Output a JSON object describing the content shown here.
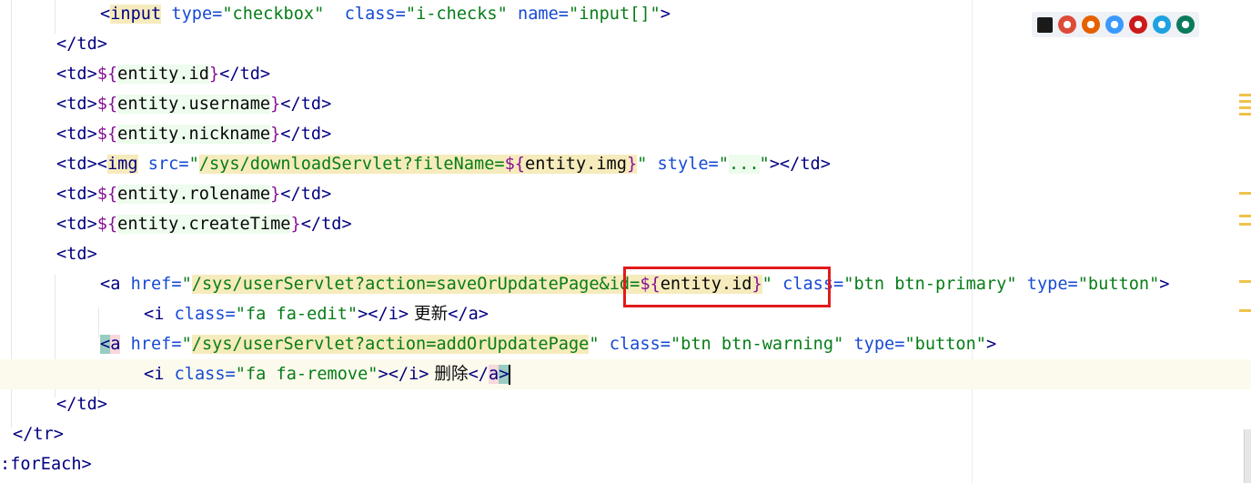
{
  "editor": {
    "lines": [
      {
        "tokens": [
          {
            "t": "<",
            "c": "tk-tag"
          },
          {
            "t": "input",
            "c": "tk-tag hl-y"
          },
          {
            "t": " type=",
            "c": "tk-attr"
          },
          {
            "t": "\"checkbox\"",
            "c": "tk-str"
          },
          {
            "t": "  class=",
            "c": "tk-attr"
          },
          {
            "t": "\"i-checks\"",
            "c": "tk-str"
          },
          {
            "t": " name=",
            "c": "tk-attr"
          },
          {
            "t": "\"input[]\"",
            "c": "tk-str"
          },
          {
            "t": ">",
            "c": "tk-tag"
          }
        ]
      },
      {
        "tokens": [
          {
            "t": "</td>",
            "c": "tk-tag"
          }
        ]
      },
      {
        "tokens": [
          {
            "t": "<td>",
            "c": "tk-tag"
          },
          {
            "t": "${",
            "c": "tk-el"
          },
          {
            "t": "entity.id",
            "c": "tk-txt hl-g"
          },
          {
            "t": "}",
            "c": "tk-el"
          },
          {
            "t": "</td>",
            "c": "tk-tag"
          }
        ]
      },
      {
        "tokens": [
          {
            "t": "<td>",
            "c": "tk-tag"
          },
          {
            "t": "${",
            "c": "tk-el"
          },
          {
            "t": "entity.username",
            "c": "tk-txt hl-g"
          },
          {
            "t": "}",
            "c": "tk-el"
          },
          {
            "t": "</td>",
            "c": "tk-tag"
          }
        ]
      },
      {
        "tokens": [
          {
            "t": "<td>",
            "c": "tk-tag"
          },
          {
            "t": "${",
            "c": "tk-el"
          },
          {
            "t": "entity.nickname",
            "c": "tk-txt hl-g"
          },
          {
            "t": "}",
            "c": "tk-el"
          },
          {
            "t": "</td>",
            "c": "tk-tag"
          }
        ]
      },
      {
        "tokens": [
          {
            "t": "<td>",
            "c": "tk-tag"
          },
          {
            "t": "<",
            "c": "tk-tag"
          },
          {
            "t": "img",
            "c": "tk-tag hl-y"
          },
          {
            "t": " src=",
            "c": "tk-attr"
          },
          {
            "t": "\"",
            "c": "tk-str"
          },
          {
            "t": "/sys/downloadServlet?fileName=",
            "c": "tk-str hl-y"
          },
          {
            "t": "${",
            "c": "tk-el hl-y"
          },
          {
            "t": "entity.img",
            "c": "tk-txt hl-y"
          },
          {
            "t": "}",
            "c": "tk-el hl-y"
          },
          {
            "t": "\"",
            "c": "tk-str"
          },
          {
            "t": " style=",
            "c": "tk-attr"
          },
          {
            "t": "\"",
            "c": "tk-str"
          },
          {
            "t": "...",
            "c": "tk-str hl-g"
          },
          {
            "t": "\"",
            "c": "tk-str"
          },
          {
            "t": "></td>",
            "c": "tk-tag"
          }
        ]
      },
      {
        "tokens": [
          {
            "t": "<td>",
            "c": "tk-tag"
          },
          {
            "t": "${",
            "c": "tk-el"
          },
          {
            "t": "entity.rolename",
            "c": "tk-txt hl-g"
          },
          {
            "t": "}",
            "c": "tk-el"
          },
          {
            "t": "</td>",
            "c": "tk-tag"
          }
        ]
      },
      {
        "tokens": [
          {
            "t": "<td>",
            "c": "tk-tag"
          },
          {
            "t": "${",
            "c": "tk-el"
          },
          {
            "t": "entity.createTime",
            "c": "tk-txt hl-g"
          },
          {
            "t": "}",
            "c": "tk-el"
          },
          {
            "t": "</td>",
            "c": "tk-tag"
          }
        ]
      },
      {
        "tokens": [
          {
            "t": "<td>",
            "c": "tk-tag"
          }
        ]
      },
      {
        "tokens": [
          {
            "t": "<a",
            "c": "tk-tag"
          },
          {
            "t": " href=",
            "c": "tk-attr"
          },
          {
            "t": "\"",
            "c": "tk-str"
          },
          {
            "t": "/sys/userServlet?action=saveOrUpdatePage&id=",
            "c": "tk-str hl-y"
          },
          {
            "t": "${",
            "c": "tk-el hl-y"
          },
          {
            "t": "entity.id",
            "c": "tk-txt hl-y"
          },
          {
            "t": "}",
            "c": "tk-el hl-y"
          },
          {
            "t": "\"",
            "c": "tk-str"
          },
          {
            "t": " class=",
            "c": "tk-attr"
          },
          {
            "t": "\"btn btn-primary\"",
            "c": "tk-str"
          },
          {
            "t": " type=",
            "c": "tk-attr"
          },
          {
            "t": "\"button\"",
            "c": "tk-str"
          },
          {
            "t": ">",
            "c": "tk-tag"
          }
        ]
      },
      {
        "tokens": [
          {
            "t": "<i",
            "c": "tk-tag"
          },
          {
            "t": " class=",
            "c": "tk-attr"
          },
          {
            "t": "\"fa fa-edit\"",
            "c": "tk-str"
          },
          {
            "t": "></i>",
            "c": "tk-tag"
          },
          {
            "t": " 更新",
            "c": "tk-txt cjk"
          },
          {
            "t": "</a>",
            "c": "tk-tag"
          }
        ]
      },
      {
        "tokens": [
          {
            "t": "<",
            "c": "tk-tag hl-c"
          },
          {
            "t": "a",
            "c": "tk-tag hl-p"
          },
          {
            "t": " href=",
            "c": "tk-attr"
          },
          {
            "t": "\"",
            "c": "tk-str"
          },
          {
            "t": "/sys/userServlet?action=addOrUpdatePage",
            "c": "tk-str hl-y"
          },
          {
            "t": "\"",
            "c": "tk-str"
          },
          {
            "t": " class=",
            "c": "tk-attr"
          },
          {
            "t": "\"btn btn-warning\"",
            "c": "tk-str"
          },
          {
            "t": " type=",
            "c": "tk-attr"
          },
          {
            "t": "\"button\"",
            "c": "tk-str"
          },
          {
            "t": ">",
            "c": "tk-tag"
          }
        ]
      },
      {
        "tokens": [
          {
            "t": "<i",
            "c": "tk-tag"
          },
          {
            "t": " class=",
            "c": "tk-attr"
          },
          {
            "t": "\"fa fa-remove\"",
            "c": "tk-str"
          },
          {
            "t": "></i>",
            "c": "tk-tag"
          },
          {
            "t": " 删除",
            "c": "tk-txt cjk"
          },
          {
            "t": "</",
            "c": "tk-tag"
          },
          {
            "t": "a",
            "c": "tk-tag hl-p"
          },
          {
            "t": ">",
            "c": "tk-tag hl-c"
          }
        ],
        "current": true,
        "caret": true
      },
      {
        "tokens": [
          {
            "t": "</td>",
            "c": "tk-tag"
          }
        ]
      },
      {
        "tokens": [
          {
            "t": "</tr>",
            "c": "tk-tag"
          }
        ]
      },
      {
        "tokens": [
          {
            "t": ":forEach>",
            "c": "tk-tag"
          }
        ]
      }
    ]
  },
  "browser_icons": [
    {
      "name": "intellij-icon",
      "color": "#1a1a1a"
    },
    {
      "name": "chrome-icon",
      "color": "#dd4b39"
    },
    {
      "name": "firefox-icon",
      "color": "#e66000"
    },
    {
      "name": "safari-icon",
      "color": "#3b99fc"
    },
    {
      "name": "opera-icon",
      "color": "#cc1b1b"
    },
    {
      "name": "ie-icon",
      "color": "#1ea2e0"
    },
    {
      "name": "edge-icon",
      "color": "#0c7a5c"
    }
  ]
}
